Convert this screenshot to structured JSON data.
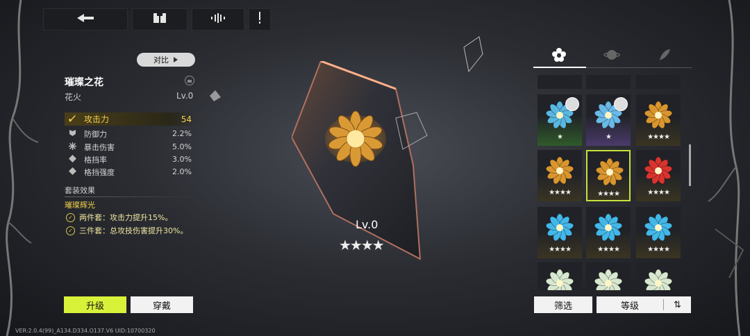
{
  "top_bar": {
    "back_icon": "back-arrow-icon",
    "inventory_icon": "gift-box-icon",
    "attribute_icon": "waveform-icon",
    "info_icon": "exclamation-icon"
  },
  "detail": {
    "compare_label": "对比",
    "item_name": "璀璨之花",
    "item_type": "花火",
    "level": "Lv.0",
    "stats": [
      {
        "icon": "sword-icon",
        "label": "攻击力",
        "value": "54",
        "highlight": true
      },
      {
        "icon": "shield-icon",
        "label": "防御力",
        "value": "2.2%"
      },
      {
        "icon": "burst-icon",
        "label": "暴击伤害",
        "value": "5.0%"
      },
      {
        "icon": "diamond-icon",
        "label": "格挡率",
        "value": "3.0%"
      },
      {
        "icon": "diamond-icon",
        "label": "格挡强度",
        "value": "2.0%"
      }
    ],
    "set_section_label": "套装效果",
    "set_name": "璀璨辉光",
    "set_bonuses": [
      "两件套：攻击力提升15%。",
      "三件套：总攻技伤害提升30%。"
    ]
  },
  "center": {
    "level": "Lv.0",
    "stars": "★★★★"
  },
  "actions": {
    "upgrade_label": "升级",
    "equip_label": "穿戴"
  },
  "version_text": "VER:2.0.4(99)_A134.D334.O137.V6   UID:10700320",
  "right_panel": {
    "tabs": [
      {
        "icon": "flower-icon",
        "active": true
      },
      {
        "icon": "planet-icon",
        "active": false
      },
      {
        "icon": "feather-icon",
        "active": false
      }
    ],
    "items": [
      {
        "color": "#59b7e0",
        "stars": "★",
        "avatar": true,
        "bg": "green"
      },
      {
        "color": "#6ab9e8",
        "stars": "★",
        "avatar": true,
        "bg": "purple"
      },
      {
        "color": "#d9962f",
        "stars": "★★★★",
        "avatar": false,
        "bg": "gold"
      },
      {
        "color": "#d9962f",
        "stars": "★★★★",
        "avatar": false,
        "bg": "gold"
      },
      {
        "color": "#d9962f",
        "stars": "★★★★",
        "avatar": false,
        "bg": "gold",
        "selected": true
      },
      {
        "color": "#d8342f",
        "stars": "★★★★",
        "avatar": false,
        "bg": "gold"
      },
      {
        "color": "#43b7e8",
        "stars": "★★★★",
        "avatar": false,
        "bg": "gold"
      },
      {
        "color": "#43b7e8",
        "stars": "★★★★",
        "avatar": false,
        "bg": "gold"
      },
      {
        "color": "#43b7e8",
        "stars": "★★★★",
        "avatar": false,
        "bg": "gold"
      },
      {
        "color": "#d8e8d0",
        "stars": "",
        "avatar": false,
        "bg": "none"
      },
      {
        "color": "#d8e8d0",
        "stars": "",
        "avatar": false,
        "bg": "none"
      },
      {
        "color": "#d8e8d0",
        "stars": "",
        "avatar": false,
        "bg": "none"
      }
    ],
    "filter_label": "筛选",
    "sort_label": "等级",
    "sort_direction_icon": "sort-arrows-icon"
  },
  "colors": {
    "accent": "#d8f23a",
    "highlight_text": "#f4d24a",
    "selection_border": "#c7e23b"
  }
}
